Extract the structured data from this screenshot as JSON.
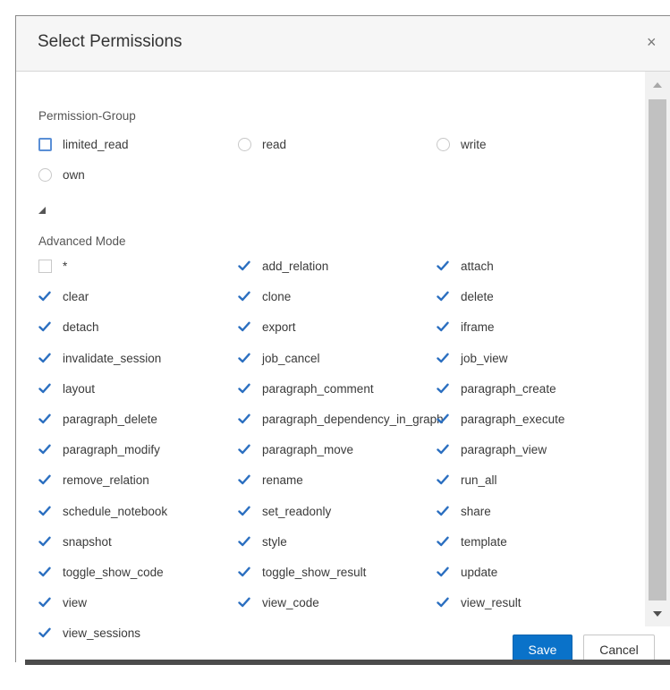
{
  "dialog": {
    "title": "Select Permissions",
    "close_glyph": "×"
  },
  "permission_group": {
    "label": "Permission-Group",
    "options": [
      {
        "label": "limited_read",
        "control": "checkbox",
        "checked": false
      },
      {
        "label": "read",
        "control": "radio",
        "checked": false
      },
      {
        "label": "write",
        "control": "radio",
        "checked": false
      },
      {
        "label": "own",
        "control": "radio",
        "checked": false
      }
    ]
  },
  "advanced_mode": {
    "label": "Advanced Mode",
    "permissions": [
      {
        "label": "*",
        "checked": false
      },
      {
        "label": "add_relation",
        "checked": true
      },
      {
        "label": "attach",
        "checked": true
      },
      {
        "label": "clear",
        "checked": true
      },
      {
        "label": "clone",
        "checked": true
      },
      {
        "label": "delete",
        "checked": true
      },
      {
        "label": "detach",
        "checked": true
      },
      {
        "label": "export",
        "checked": true
      },
      {
        "label": "iframe",
        "checked": true
      },
      {
        "label": "invalidate_session",
        "checked": true
      },
      {
        "label": "job_cancel",
        "checked": true
      },
      {
        "label": "job_view",
        "checked": true
      },
      {
        "label": "layout",
        "checked": true
      },
      {
        "label": "paragraph_comment",
        "checked": true
      },
      {
        "label": "paragraph_create",
        "checked": true
      },
      {
        "label": "paragraph_delete",
        "checked": true
      },
      {
        "label": "paragraph_dependency_in_graph",
        "checked": true
      },
      {
        "label": "paragraph_execute",
        "checked": true
      },
      {
        "label": "paragraph_modify",
        "checked": true
      },
      {
        "label": "paragraph_move",
        "checked": true
      },
      {
        "label": "paragraph_view",
        "checked": true
      },
      {
        "label": "remove_relation",
        "checked": true
      },
      {
        "label": "rename",
        "checked": true
      },
      {
        "label": "run_all",
        "checked": true
      },
      {
        "label": "schedule_notebook",
        "checked": true
      },
      {
        "label": "set_readonly",
        "checked": true
      },
      {
        "label": "share",
        "checked": true
      },
      {
        "label": "snapshot",
        "checked": true
      },
      {
        "label": "style",
        "checked": true
      },
      {
        "label": "template",
        "checked": true
      },
      {
        "label": "toggle_show_code",
        "checked": true
      },
      {
        "label": "toggle_show_result",
        "checked": true
      },
      {
        "label": "update",
        "checked": true
      },
      {
        "label": "view",
        "checked": true
      },
      {
        "label": "view_code",
        "checked": true
      },
      {
        "label": "view_result",
        "checked": true
      },
      {
        "label": "view_sessions",
        "checked": true
      }
    ]
  },
  "footer": {
    "save_label": "Save",
    "cancel_label": "Cancel"
  },
  "colors": {
    "accent": "#0a72c9",
    "check": "#2b6fc0",
    "header_bg": "#f6f6f6"
  },
  "icons": {
    "close": "close-icon",
    "collapse": "collapse-triangle-icon",
    "check": "checkmark-icon"
  }
}
